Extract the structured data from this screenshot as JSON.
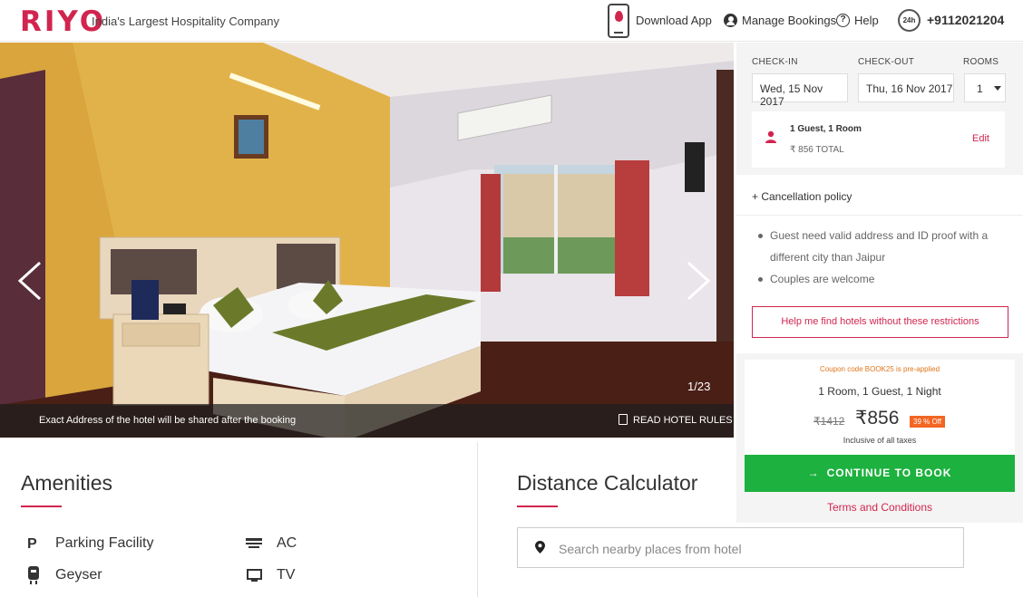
{
  "header": {
    "logo": "RIYO",
    "tagline": "India's Largest Hospitality Company",
    "download_app": "Download App",
    "manage_bookings": "Manage Bookings",
    "help": "Help",
    "support_badge": "24h",
    "phone": "+9112021204",
    "brand_color": "#d1254f"
  },
  "gallery": {
    "counter": "1/23",
    "address_note": "Exact Address of the hotel will be shared after the booking",
    "read_rules": "READ HOTEL RULES"
  },
  "booking": {
    "checkin_label": "CHECK-IN",
    "checkout_label": "CHECK-OUT",
    "rooms_label": "ROOMS",
    "checkin_value": "Wed, 15 Nov 2017",
    "checkout_value": "Thu, 16 Nov 2017",
    "rooms_value": "1",
    "guest_summary": "1 Guest, 1 Room",
    "total": "₹  856 TOTAL",
    "edit": "Edit"
  },
  "policy": {
    "title": "+ Cancellation policy",
    "items": [
      "Guest need valid address and ID proof with a different city than Jaipur",
      "Couples are welcome"
    ],
    "help_button": "Help me find hotels without these restrictions"
  },
  "price": {
    "coupon_note": "Coupon code BOOK25 is pre-applied",
    "room_summary": "1 Room, 1 Guest, 1 Night",
    "old_price": "₹1412",
    "new_price": "₹856",
    "discount": "39 % Off",
    "tax_note": "Inclusive of all taxes",
    "continue": "CONTINUE TO BOOK",
    "terms": "Terms and Conditions",
    "accent_green": "#1db13f",
    "discount_color": "#f26522"
  },
  "amenities": {
    "title": "Amenities",
    "items": [
      {
        "label": "Parking Facility",
        "icon": "parking-icon"
      },
      {
        "label": "AC",
        "icon": "ac-icon"
      },
      {
        "label": "Geyser",
        "icon": "geyser-icon"
      },
      {
        "label": "TV",
        "icon": "tv-icon"
      }
    ]
  },
  "distance": {
    "title": "Distance Calculator",
    "placeholder": "Search nearby places from hotel"
  }
}
